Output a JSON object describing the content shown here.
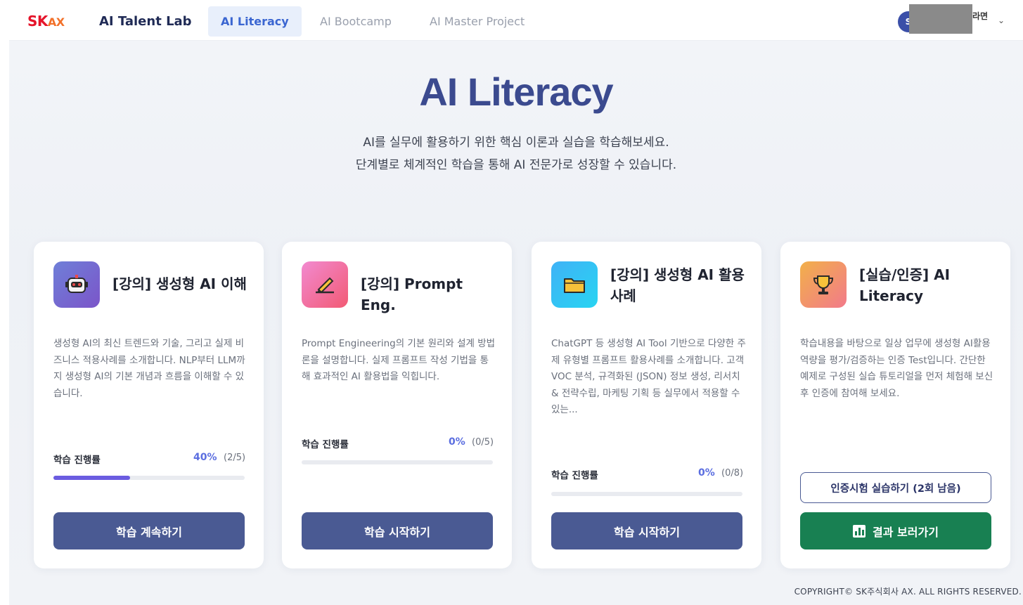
{
  "header": {
    "logo_sk": "SK",
    "logo_ax": "AX",
    "nav": {
      "talent_lab": "AI Talent Lab",
      "literacy": "AI Literacy",
      "bootcamp": "AI Bootcamp",
      "master_project": "AI Master Project"
    },
    "user": {
      "avatar_initial": "S",
      "name_fragment": "라면"
    }
  },
  "hero": {
    "title": "AI Literacy",
    "desc_line1": "AI를 실무에 활용하기 위한 핵심 이론과 실습을 학습해보세요.",
    "desc_line2": "단계별로 체계적인 학습을 통해 AI 전문가로 성장할 수 있습니다."
  },
  "cards": [
    {
      "icon": "robot-icon",
      "title": "[강의] 생성형 AI 이해",
      "desc": "생성형 AI의 최신 트렌드와 기술, 그리고 실제 비즈니스 적용사례를 소개합니다. NLP부터 LLM까지 생성형 AI의 기본 개념과 흐름을 이해할 수 있습니다.",
      "progress_label": "학습 진행률",
      "progress_pct": "40%",
      "progress_count": "(2/5)",
      "progress_value": 0.4,
      "button": "학습 계속하기"
    },
    {
      "icon": "pencil-icon",
      "title": "[강의] Prompt Eng.",
      "desc": "Prompt Engineering의 기본 원리와 설계 방법론을 설명합니다. 실제 프롬프트 작성 기법을 통해 효과적인 AI 활용법을 익힙니다.",
      "progress_label": "학습 진행률",
      "progress_pct": "0%",
      "progress_count": "(0/5)",
      "progress_value": 0,
      "button": "학습 시작하기"
    },
    {
      "icon": "folder-icon",
      "title": "[강의] 생성형 AI 활용사례",
      "desc": "ChatGPT 등 생성형 AI Tool 기반으로 다양한 주제 유형별 프롬프트 활용사례를 소개합니다. 고객 VOC 분석, 규격화된 (JSON) 정보 생성, 리서치 & 전략수립, 마케팅 기획 등 실무에서 적용할 수 있는...",
      "progress_label": "학습 진행률",
      "progress_pct": "0%",
      "progress_count": "(0/8)",
      "progress_value": 0,
      "button": "학습 시작하기"
    },
    {
      "icon": "trophy-icon",
      "title": "[실습/인증] AI Literacy",
      "desc": "학습내용을 바탕으로 일상 업무에 생성형 AI활용 역량을 평가/검증하는 인증 Test입니다. 간단한 예제로 구성된 실습 튜토리얼을 먼저 체험해 보신 후 인증에 참여해 보세요.",
      "outline_button": "인증시험 실습하기 (2회 남음)",
      "green_button": "결과 보러가기"
    }
  ],
  "footer": {
    "copyright": "COPYRIGHT© SK주식회사 AX. ALL RIGHTS RESERVED."
  },
  "colors": {
    "accent": "#3b66d1",
    "button": "#4a5a93",
    "green": "#188052",
    "progress": "#6b5ce0"
  }
}
